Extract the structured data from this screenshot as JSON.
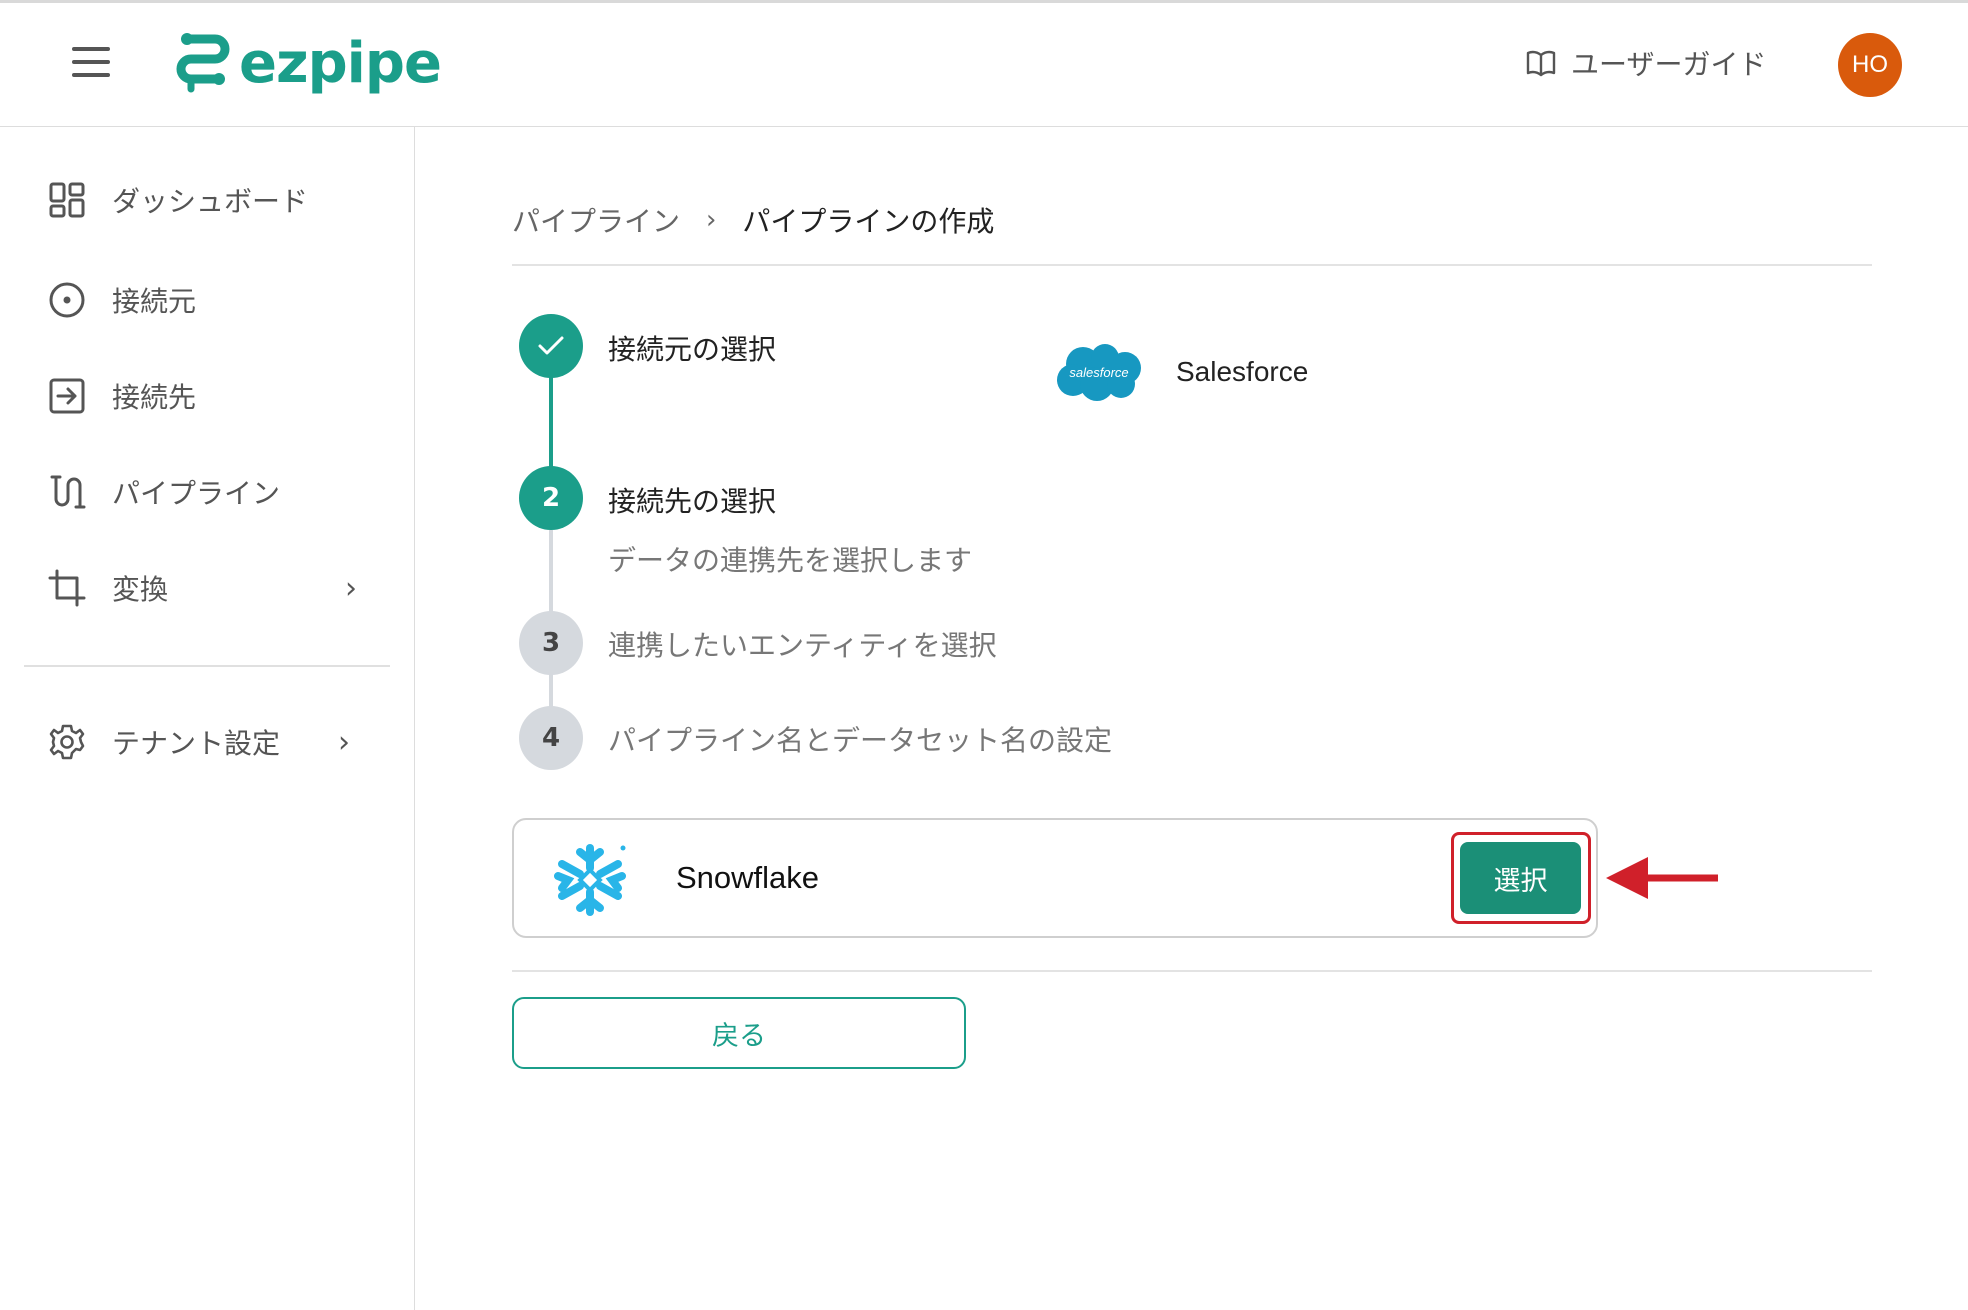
{
  "header": {
    "logo_text": "ezpipe",
    "guide_label": "ユーザーガイド",
    "avatar_initials": "HO",
    "avatar_color": "#d95a0c"
  },
  "sidebar": {
    "items": [
      {
        "label": "ダッシュボード",
        "icon": "dashboard-icon"
      },
      {
        "label": "接続元",
        "icon": "source-icon"
      },
      {
        "label": "接続先",
        "icon": "destination-icon"
      },
      {
        "label": "パイプライン",
        "icon": "pipeline-icon"
      },
      {
        "label": "変換",
        "icon": "crop-icon"
      },
      {
        "label": "テナント設定",
        "icon": "gear-icon"
      }
    ]
  },
  "breadcrumb": {
    "parent": "パイプライン",
    "separator": "›",
    "current": "パイプラインの作成"
  },
  "steps": [
    {
      "number": "",
      "title": "接続元の選択",
      "state": "done",
      "selected_value": "Salesforce"
    },
    {
      "number": "2",
      "title": "接続先の選択",
      "state": "active",
      "description": "データの連携先を選択します"
    },
    {
      "number": "3",
      "title": "連携したいエンティティを選択",
      "state": "pending"
    },
    {
      "number": "4",
      "title": "パイプライン名とデータセット名の設定",
      "state": "pending"
    }
  ],
  "salesforce_logo_text": "salesforce",
  "destination_card": {
    "name": "Snowflake",
    "select_label": "選択"
  },
  "back_label": "戻る",
  "colors": {
    "accent": "#1b9e8a",
    "pending": "#d5d9de",
    "highlight": "#d0202a"
  }
}
